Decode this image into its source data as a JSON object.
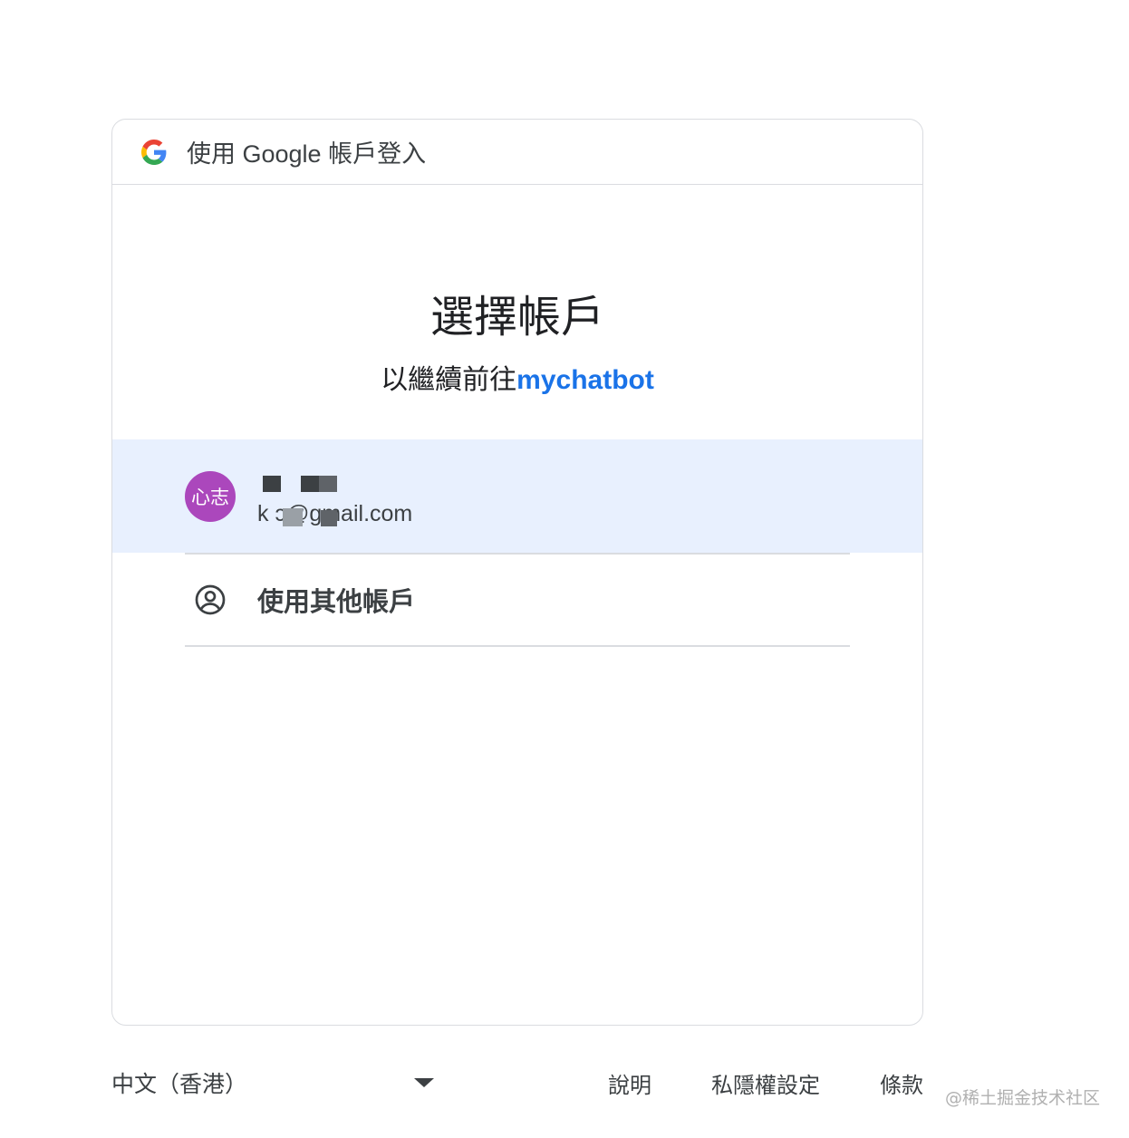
{
  "header": {
    "logo_icon": "google-g-icon",
    "title": "使用 Google 帳戶登入"
  },
  "main": {
    "title": "選擇帳戶",
    "subtitle_prefix": "以繼續前往",
    "app_name": "mychatbot",
    "app_color": "#1a73e8"
  },
  "account": {
    "avatar_text": "心志",
    "avatar_color": "#ab47bc",
    "email_visible": "k          ɔ@gmail.com",
    "highlight_color": "#e8f0fe"
  },
  "other_account": {
    "icon": "account-circle-icon",
    "label": "使用其他帳戶"
  },
  "footer": {
    "language": "中文（香港）",
    "links": [
      "說明",
      "私隱權設定",
      "條款"
    ]
  },
  "watermark": "@稀土掘金技术社区"
}
